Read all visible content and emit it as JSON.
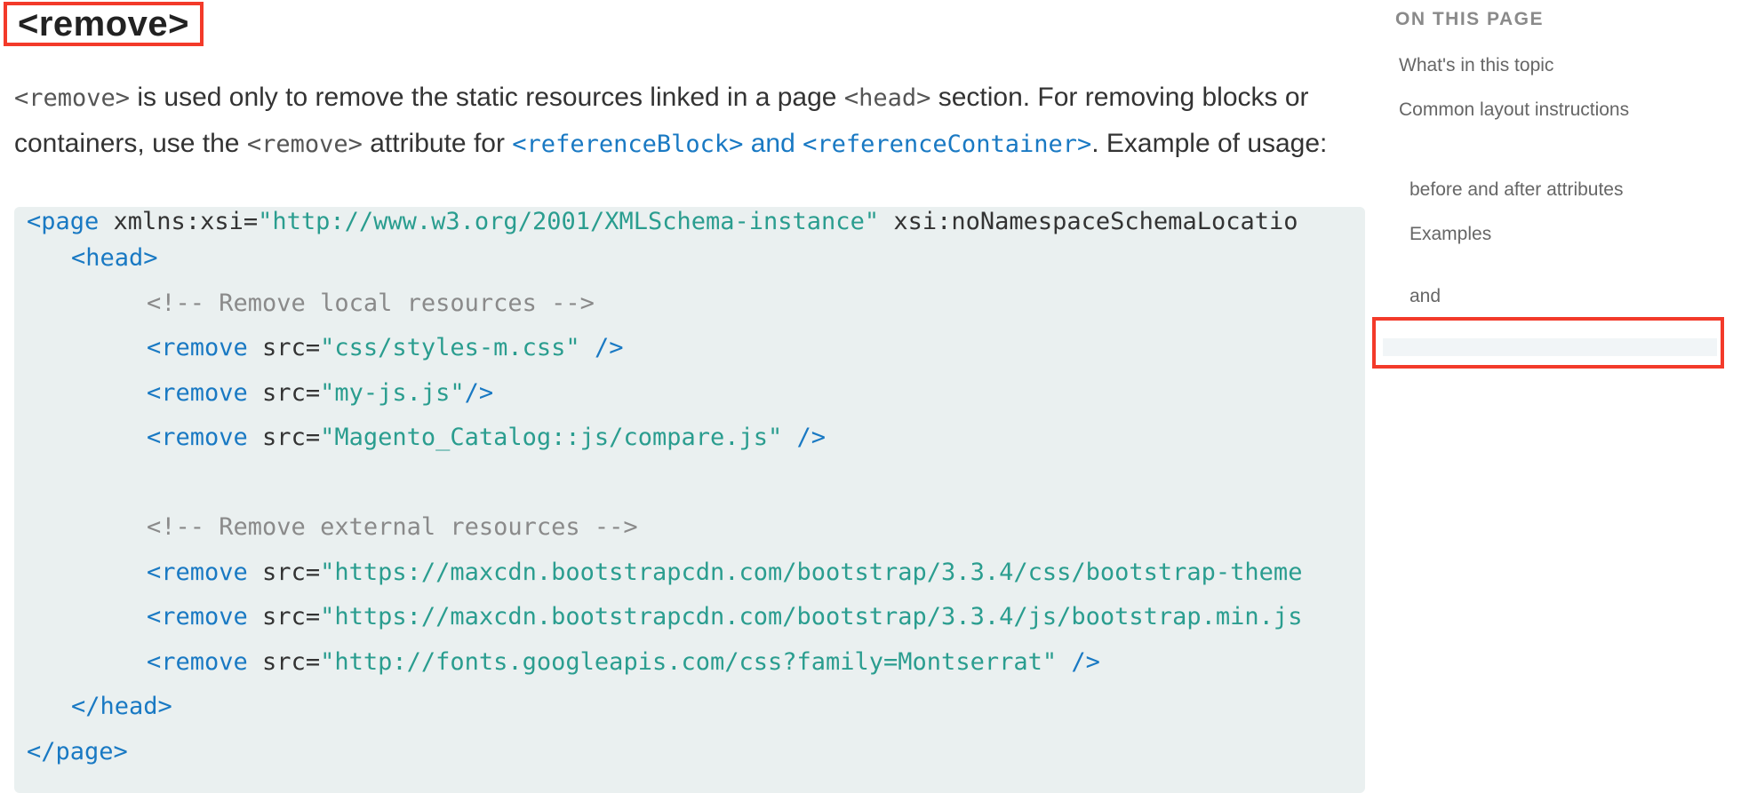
{
  "article": {
    "heading": "<remove>",
    "paragraph": {
      "t1": "<remove>",
      "t2": " is used only to remove the static resources linked in a page ",
      "t3": "<head>",
      "t4": " section. For removing blocks or containers, use the ",
      "t5": "<remove>",
      "t6": " attribute for ",
      "link1": "<referenceBlock>",
      "link_and": " and ",
      "link2": "<referenceContainer>",
      "t7": ". Example of usage:"
    },
    "code": {
      "l1_tag": "<page",
      "l1_attr1": " xmlns:xsi=",
      "l1_str1": "\"http://www.w3.org/2001/XMLSchema-instance\"",
      "l1_attr2": " xsi:noNamespaceSchemaLocatio",
      "l2_tag": "<head>",
      "l3_cmt": "<!-- Remove local resources -->",
      "l4_tag": "<remove",
      "l4_attr": " src=",
      "l4_str": "\"css/styles-m.css\"",
      "l4_end": " />",
      "l5_tag": "<remove",
      "l5_attr": " src=",
      "l5_str": "\"my-js.js\"",
      "l5_end": "/>",
      "l6_tag": "<remove",
      "l6_attr": " src=",
      "l6_str": "\"Magento_Catalog::js/compare.js\"",
      "l6_end": " />",
      "l8_cmt": "<!-- Remove external resources -->",
      "l9_tag": "<remove",
      "l9_attr": " src=",
      "l9_str": "\"https://maxcdn.bootstrapcdn.com/bootstrap/3.3.4/css/bootstrap-theme",
      "l10_tag": "<remove",
      "l10_attr": " src=",
      "l10_str": "\"https://maxcdn.bootstrapcdn.com/bootstrap/3.3.4/js/bootstrap.min.js",
      "l11_tag": "<remove",
      "l11_attr": " src=",
      "l11_str": "\"http://fonts.googleapis.com/css?family=Montserrat\"",
      "l11_end": " />",
      "l12_tag": "</head>",
      "l13_tag": "</page>"
    }
  },
  "toc": {
    "title": "ON THIS PAGE",
    "items": [
      "What's in this topic",
      "Common layout instructions",
      "before and after attributes",
      "Examples",
      "and"
    ]
  },
  "colors": {
    "highlight_border": "#f33a2a",
    "link": "#1979c3",
    "string": "#2a9d8f",
    "code_background": "#eaf0f0"
  }
}
